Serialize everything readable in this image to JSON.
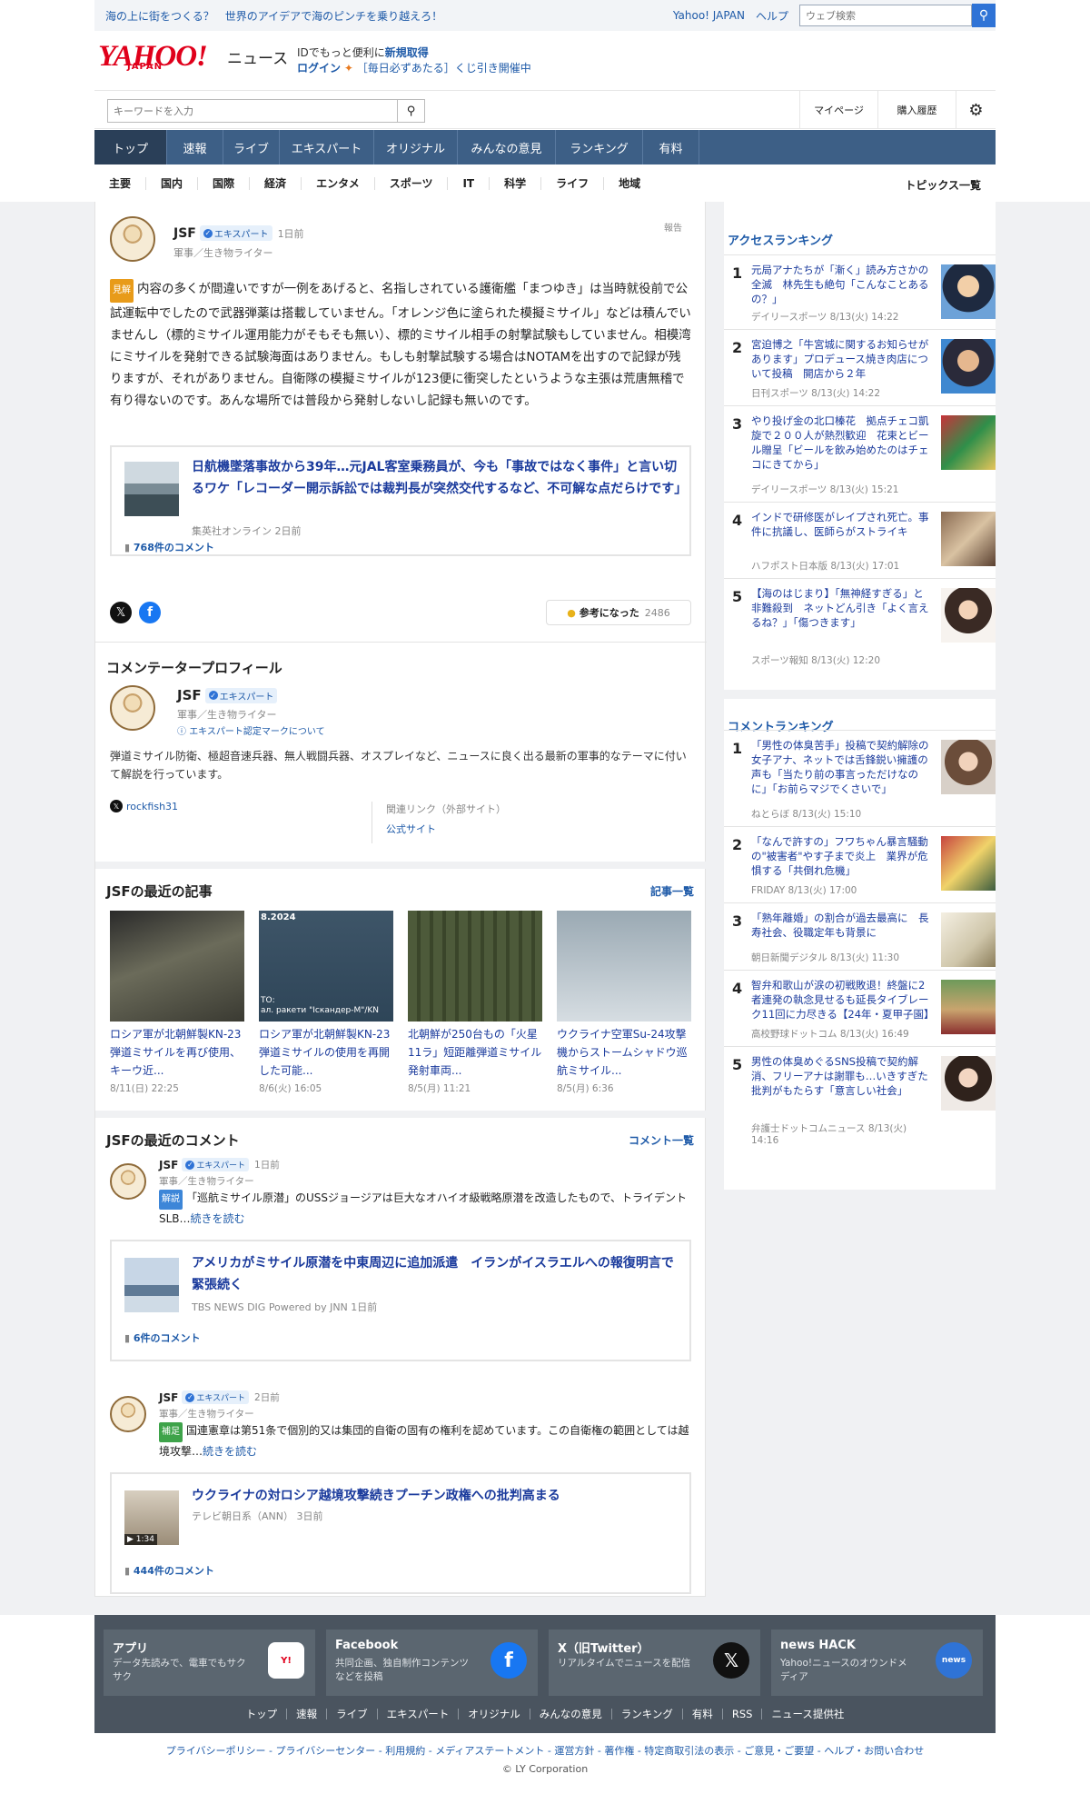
{
  "header": {
    "promo": "海の上に街をつくる？　世界のアイデアで海のピンチを乗り越えろ！",
    "yahoo_link": "Yahoo! JAPAN",
    "help_link": "ヘルプ",
    "web_search_placeholder": "ウェブ検索",
    "logo_text": "YAHOO!",
    "logo_sub": "JAPAN",
    "news_label": "ニュース",
    "id_prefix": "IDでもっと便利に",
    "id_signup": "新規取得",
    "login": "ログイン",
    "lottery": "［毎日必ずあたる］くじ引き開催中"
  },
  "search": {
    "placeholder": "キーワードを入力",
    "mypage": "マイページ",
    "purchase_history": "購入履歴"
  },
  "main_nav": [
    "トップ",
    "速報",
    "ライブ",
    "エキスパート",
    "オリジナル",
    "みんなの意見",
    "ランキング",
    "有料"
  ],
  "sub_nav": [
    "主要",
    "国内",
    "国際",
    "経済",
    "エンタメ",
    "スポーツ",
    "IT",
    "科学",
    "ライフ",
    "地域"
  ],
  "topics_all": "トピックス一覧",
  "comment": {
    "author": "JSF",
    "expert_label": "エキスパート",
    "time": "1日前",
    "role": "軍事／生き物ライター",
    "report": "報告",
    "tag": "見解",
    "tag_color": "#e89b1a",
    "body": "内容の多くが間違いですが一例をあげると、名指しされている護衛艦「まつゆき」は当時就役前で公試運転中でしたので武器弾薬は搭載していません。「オレンジ色に塗られた模擬ミサイル」などは積んでいませんし（標的ミサイル運用能力がそもそも無い）、標的ミサイル相手の射撃試験もしていません。相模湾にミサイルを発射できる試験海面はありません。もしも射撃試験する場合はNOTAMを出すので記録が残りますが、それがありません。自衛隊の模擬ミサイルが123便に衝突したというような主張は荒唐無稽で有り得ないのです。あんな場所では普段から発射しないし記録も無いのです。",
    "article": {
      "title": "日航機墜落事故から39年…元JAL客室乗務員が、今も「事故ではなく事件」と言い切るワケ「レコーダー開示訴訟では裁判長が突然交代するなど、不可解な点だらけです」",
      "source": "集英社オンライン",
      "time": "2日前",
      "comments": "768件のコメント"
    },
    "helpful_label": "参考になった",
    "helpful_count": "2486"
  },
  "profile": {
    "section_title": "コメンテータープロフィール",
    "name": "JSF",
    "expert_label": "エキスパート",
    "role": "軍事／生き物ライター",
    "about_mark": "エキスパート認定マークについて",
    "bio": "弾道ミサイル防衛、極超音速兵器、無人戦闘兵器、オスプレイなど、ニュースに良く出る最新の軍事的なテーマに付いて解説を行っています。",
    "x_handle": "rockfish31",
    "related_label": "関連リンク（外部サイト）",
    "official_site": "公式サイト"
  },
  "recent_articles": {
    "title": "JSFの最近の記事",
    "more": "記事一覧",
    "items": [
      {
        "title": "ロシア軍が北朝鮮製KN-23弾道ミサイルを再び使用、キーウ近...",
        "date": "8/11(日) 22:25"
      },
      {
        "title": "ロシア軍が北朝鮮製KN-23弾道ミサイルの使用を再開した可能...",
        "date": "8/6(火) 16:05",
        "thumb_text": "8.2024",
        "thumb_text2": "ТО:\nал. ракети \"Іскандер-М\"/KN"
      },
      {
        "title": "北朝鮮が250台もの「火星11ラ」短距離弾道ミサイル発射車両...",
        "date": "8/5(月) 11:21"
      },
      {
        "title": "ウクライナ空軍Su-24攻撃機からストームシャドウ巡航ミサイル...",
        "date": "8/5(月) 6:36"
      }
    ]
  },
  "recent_comments": {
    "title": "JSFの最近のコメント",
    "more": "コメント一覧",
    "items": [
      {
        "author": "JSF",
        "expert_label": "エキスパート",
        "time": "1日前",
        "role": "軍事／生き物ライター",
        "tag": "解説",
        "tag_color": "#3d86d8",
        "body": "「巡航ミサイル原潜」のUSSジョージアは巨大なオハイオ級戦略原潜を改造したもので、トライデントSLB…",
        "read_more": "続きを読む",
        "article_title": "アメリカがミサイル原潜を中東周辺に追加派遣　イランがイスラエルへの報復明言で緊張続く",
        "article_source": "TBS NEWS DIG Powered by JNN",
        "article_time": "1日前",
        "comments": "6件のコメント"
      },
      {
        "author": "JSF",
        "expert_label": "エキスパート",
        "time": "2日前",
        "role": "軍事／生き物ライター",
        "tag": "補足",
        "tag_color": "#3ea34a",
        "body": "国連憲章は第51条で個別的又は集団的自衛の固有の権利を認めています。この自衛権の範囲としては越境攻撃…",
        "read_more": "続きを読む",
        "article_title": "ウクライナの対ロシア越境攻撃続きプーチン政権への批判高まる",
        "article_source": "テレビ朝日系（ANN）",
        "article_time": "3日前",
        "video_duration": "1:34",
        "comments": "444件のコメント"
      }
    ]
  },
  "access_ranking": {
    "title": "アクセスランキング",
    "items": [
      {
        "num": "1",
        "title": "元局アナたちが「漸く」読み方さかの全滅　林先生も絶句「こんなことあるの？」",
        "source": "デイリースポーツ",
        "time": "8/13(火) 14:22"
      },
      {
        "num": "2",
        "title": "宮迫博之「牛宮城に関するお知らせがあります」プロデュース焼き肉店について投稿　開店から２年",
        "source": "日刊スポーツ",
        "time": "8/13(火) 14:22"
      },
      {
        "num": "3",
        "title": "やり投げ金の北口榛花　拠点チェコ凱旋で２００人が熱烈歓迎　花束とビール贈呈「ビールを飲み始めたのはチェコにきてから」",
        "source": "デイリースポーツ",
        "time": "8/13(火) 15:21"
      },
      {
        "num": "4",
        "title": "インドで研修医がレイプされ死亡。事件に抗議し、医師らがストライキ",
        "source": "ハフポスト日本版",
        "time": "8/13(火) 17:01"
      },
      {
        "num": "5",
        "title": "【海のはじまり】「無神経すぎる」と非難殺到　ネットどん引き「よく言えるね？」「傷つきます」",
        "source": "スポーツ報知",
        "time": "8/13(火) 12:20"
      }
    ]
  },
  "comment_ranking": {
    "title": "コメントランキング",
    "items": [
      {
        "num": "1",
        "title": "「男性の体臭苦手」投稿で契約解除の女子アナ、ネットでは舌鋒鋭い擁護の声も「当たり前の事言っただけなのに」「お前らマジでくさいで」",
        "source": "ねとらぼ",
        "time": "8/13(火) 15:10"
      },
      {
        "num": "2",
        "title": "「なんで許すの」フワちゃん暴言騒動の\"被害者\"やす子まで炎上　業界が危惧する「共倒れ危機」",
        "source": "FRIDAY",
        "time": "8/13(火) 17:00"
      },
      {
        "num": "3",
        "title": "「熟年離婚」の割合が過去最高に　長寿社会、役職定年も背景に",
        "source": "朝日新聞デジタル",
        "time": "8/13(火) 11:30"
      },
      {
        "num": "4",
        "title": "智弁和歌山が涙の初戦敗退！終盤に2者連発の執念見せるも延長タイブレーク11回に力尽きる【24年・夏甲子園】",
        "source": "高校野球ドットコム",
        "time": "8/13(火) 16:49"
      },
      {
        "num": "5",
        "title": "男性の体臭めぐるSNS投稿で契約解消、フリーアナは謝罪も…いきすぎた批判がもたらす「意言しい社会」",
        "source": "弁護士ドットコムニュース",
        "time": "8/13(火) 14:16"
      }
    ]
  },
  "footer": {
    "boxes": [
      {
        "title": "アプリ",
        "desc": "データ先読みで、電車でもサクサク",
        "icon": "yahoo-app-icon"
      },
      {
        "title": "Facebook",
        "desc": "共同企画、独自制作コンテンツなどを投稿",
        "icon": "facebook-icon"
      },
      {
        "title": "X（旧Twitter）",
        "desc": "リアルタイムでニュースを配信",
        "icon": "x-icon"
      },
      {
        "title": "news HACK",
        "desc": "Yahoo!ニュースのオウンドメディア",
        "icon": "news-hack-icon"
      }
    ],
    "links": [
      "トップ",
      "速報",
      "ライブ",
      "エキスパート",
      "オリジナル",
      "みんなの意見",
      "ランキング",
      "有料",
      "RSS",
      "ニュース提供社"
    ],
    "legal": "プライバシーポリシー - プライバシーセンター - 利用規約 - メディアステートメント - 運営方針 - 著作権 - 特定商取引法の表示 - ご意見・ご要望 - ヘルプ・お問い合わせ",
    "copyright": "© LY Corporation"
  }
}
